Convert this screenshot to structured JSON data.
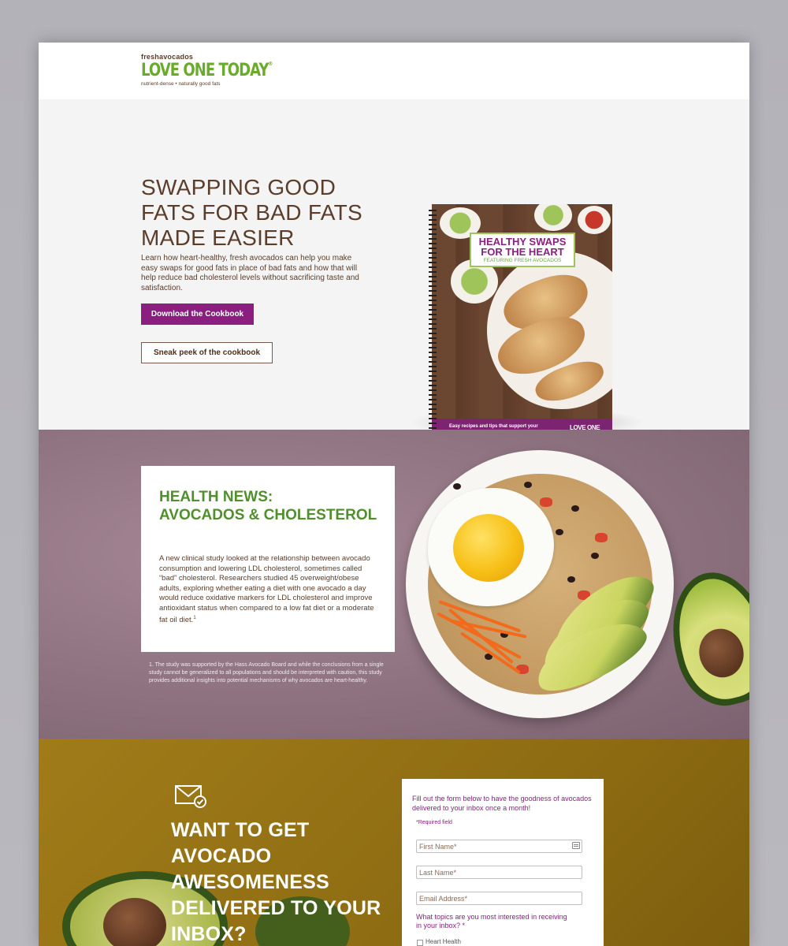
{
  "header": {
    "logo_small_prefix": "fresh",
    "logo_small_brand": "avocados",
    "logo_main": "LOVE ONE TODAY",
    "logo_reg": "®",
    "logo_tagline": "nutrient-dense • naturally good fats"
  },
  "hero": {
    "title": "SWAPPING GOOD FATS FOR BAD FATS MADE EASIER",
    "description": "Learn how heart-healthy, fresh avocados can help you make easy swaps for good fats in place of bad fats and how that will help reduce bad cholesterol levels without sacrificing taste and satisfaction.",
    "primary_button": "Download the Cookbook",
    "secondary_button": "Sneak peek of the cookbook",
    "book": {
      "title": "HEALTHY SWAPS FOR THE HEART",
      "subtitle": "FEATURING FRESH AVOCADOS",
      "band_text": "Easy recipes and tips that support your everyday heart-healthy living goals",
      "band_logo": "LOVE ONE TODAY"
    }
  },
  "health": {
    "title_bold": "HEALTH NEWS:",
    "title_light": "AVOCADOS & CHOLESTEROL",
    "body": "A new clinical study looked at the relationship between avocado consumption and lowering LDL cholesterol, sometimes called “bad” cholesterol. Researchers studied 45 overweight/obese adults, exploring whether eating a diet with one avocado a day would reduce oxidative markers for LDL cholesterol and improve antioxidant status when compared to a low fat diet or a moderate fat oil diet.",
    "body_sup": "1",
    "footnote": "1. The study was supported by the Hass Avocado Board and while the conclusions from a single study cannot be generalized to all populations and should be interpreted with caution, this study provides additional insights into potential mechanisms of why avocados are heart-healthy."
  },
  "subscribe": {
    "title": "WANT TO GET AVOCADO AWESOMENESS DELIVERED TO YOUR INBOX?",
    "form_intro": "Fill out the form below to have the goodness of avocados delivered to your inbox once a month!",
    "required_note": "*Required field",
    "first_name_placeholder": "First Name*",
    "last_name_placeholder": "Last Name*",
    "email_placeholder": "Email Address*",
    "topics_question": "What topics are you most interested in receiving in your inbox? *",
    "topic_option_1": "Heart Health"
  },
  "colors": {
    "brand_purple": "#8b1f7f",
    "brand_green": "#6aab2e",
    "brand_brown": "#5a3d2b",
    "mustard_bg": "#8e6c12"
  }
}
